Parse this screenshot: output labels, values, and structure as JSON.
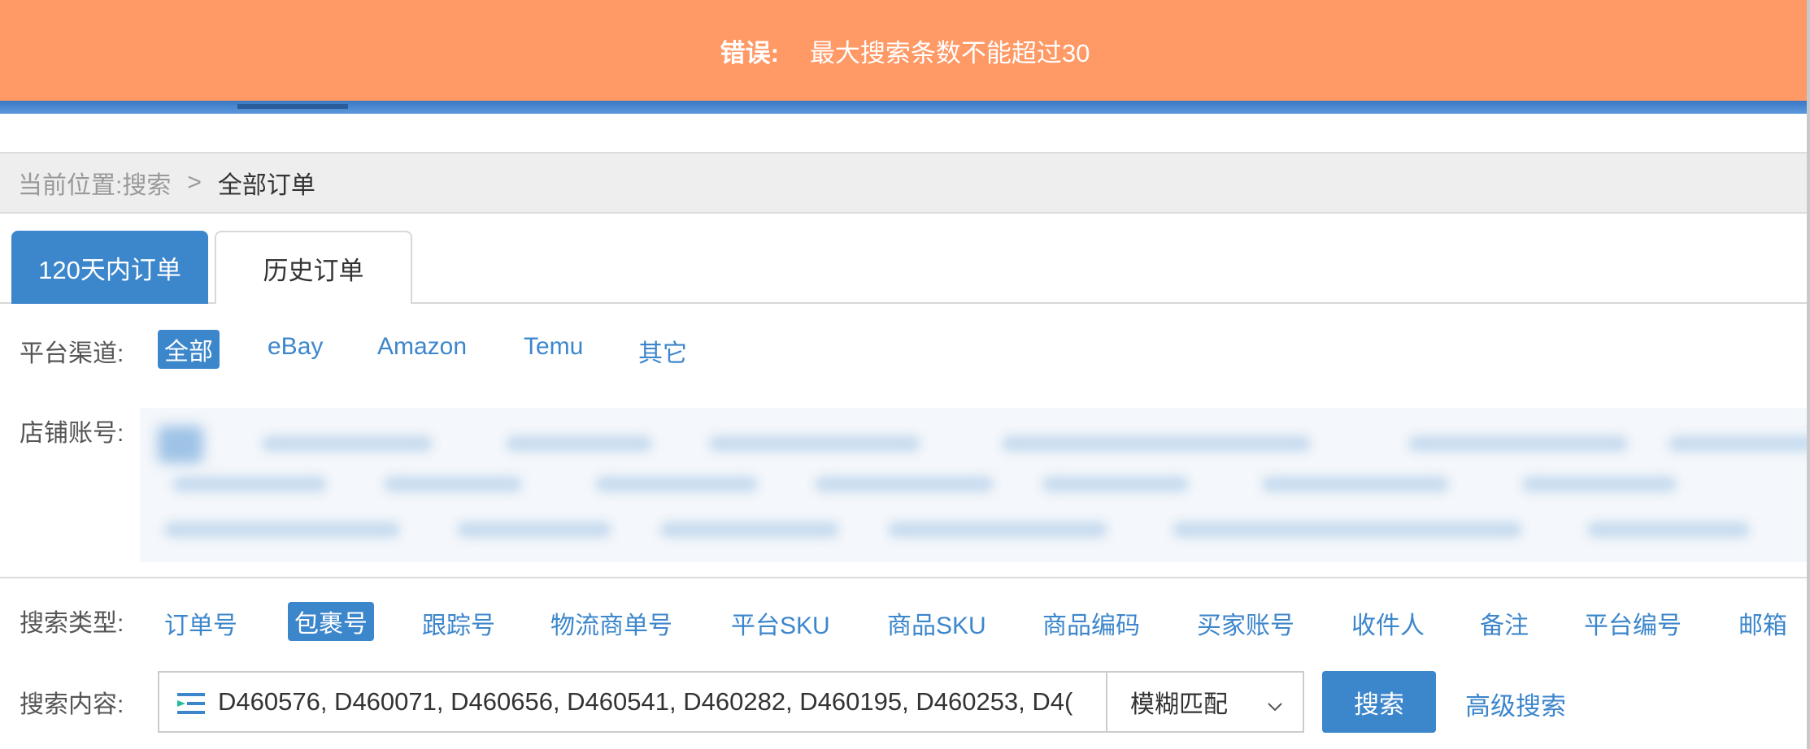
{
  "error": {
    "label": "错误:",
    "message": "最大搜索条数不能超过30"
  },
  "breadcrumb": {
    "prefix": "当前位置:",
    "parent": "搜索",
    "separator": ">",
    "current": "全部订单"
  },
  "tabs": [
    {
      "label": "120天内订单",
      "active": true
    },
    {
      "label": "历史订单",
      "active": false
    }
  ],
  "platform": {
    "label": "平台渠道:",
    "options": [
      "全部",
      "eBay",
      "Amazon",
      "Temu",
      "其它"
    ],
    "selected": "全部"
  },
  "store": {
    "label": "店铺账号:"
  },
  "search_type": {
    "label": "搜索类型:",
    "options": [
      "订单号",
      "包裹号",
      "跟踪号",
      "物流商单号",
      "平台SKU",
      "商品SKU",
      "商品编码",
      "买家账号",
      "收件人",
      "备注",
      "平台编号",
      "邮箱"
    ],
    "selected": "包裹号"
  },
  "search_content": {
    "label": "搜索内容:",
    "value": "D460576, D460071, D460656, D460541, D460282, D460195, D460253, D4(",
    "match_mode": "模糊匹配",
    "search_button": "搜索",
    "advanced_link": "高级搜索"
  },
  "colors": {
    "accent": "#3c86cc",
    "error_banner": "#ff9966"
  }
}
